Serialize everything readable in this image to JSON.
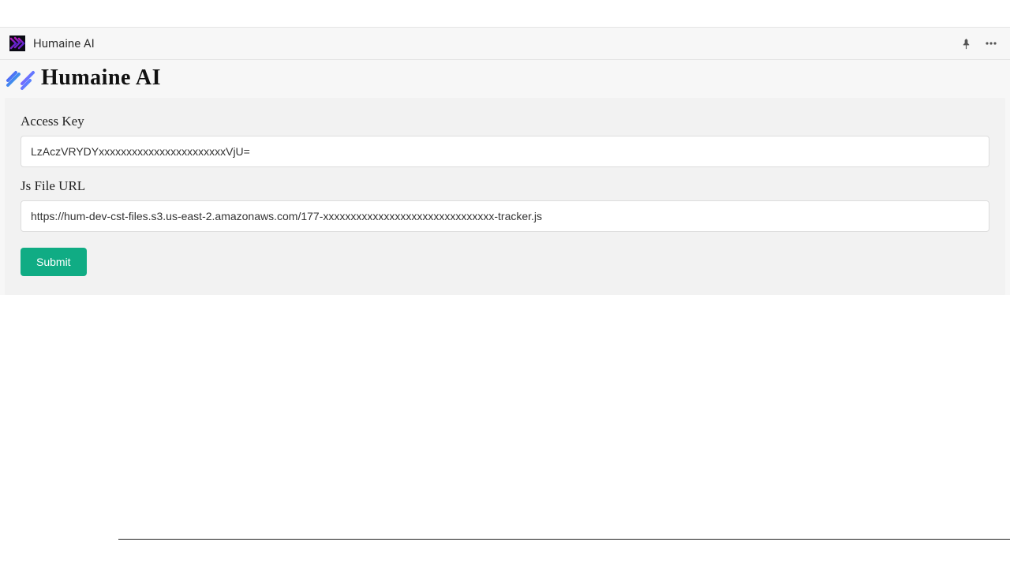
{
  "titlebar": {
    "app_name": "Humaine AI"
  },
  "brand": {
    "name": "Humaine AI"
  },
  "form": {
    "access_key": {
      "label": "Access Key",
      "value": "LzAczVRYDYxxxxxxxxxxxxxxxxxxxxxxxVjU="
    },
    "js_file_url": {
      "label": "Js File URL",
      "value": "https://hum-dev-cst-files.s3.us-east-2.amazonaws.com/177-xxxxxxxxxxxxxxxxxxxxxxxxxxxxxxx-tracker.js"
    },
    "submit_label": "Submit"
  }
}
